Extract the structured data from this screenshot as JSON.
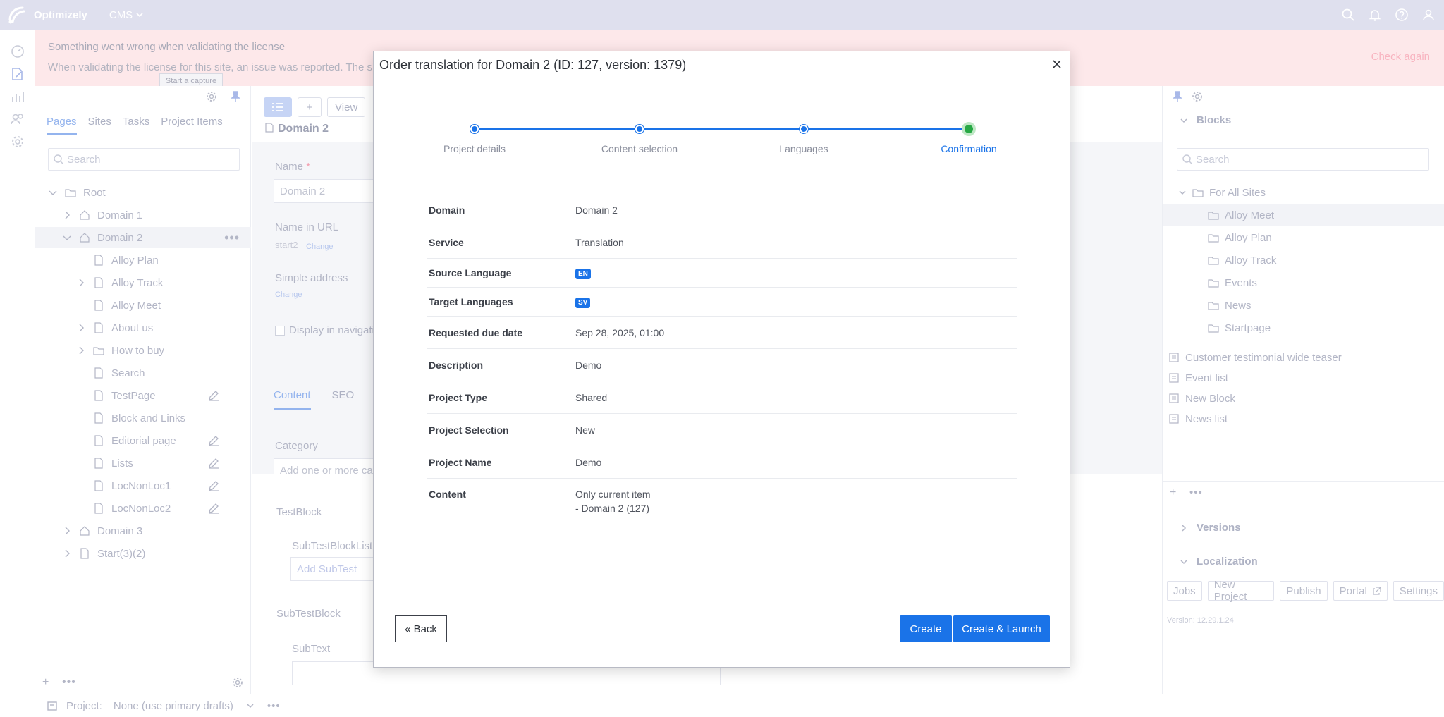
{
  "topbar": {
    "brand": "Optimizely",
    "product_menu": "CMS"
  },
  "banner": {
    "title": "Something went wrong when validating the license",
    "message": "When validating the license for this site, an issue was reported. The si",
    "action": "Check again"
  },
  "tooltip": "Start a capture",
  "left_pane": {
    "tabs": [
      "Pages",
      "Sites",
      "Tasks",
      "Project Items"
    ],
    "search_placeholder": "Search",
    "tree": [
      {
        "label": "Root",
        "depth": 0,
        "icon": "folder",
        "toggle": "open"
      },
      {
        "label": "Domain 1",
        "depth": 1,
        "icon": "home",
        "toggle": "closed"
      },
      {
        "label": "Domain 2",
        "depth": 1,
        "icon": "home",
        "toggle": "open",
        "selected": true
      },
      {
        "label": "Alloy Plan",
        "depth": 2,
        "icon": "page"
      },
      {
        "label": "Alloy Track",
        "depth": 2,
        "icon": "page",
        "toggle": "closed"
      },
      {
        "label": "Alloy Meet",
        "depth": 2,
        "icon": "page"
      },
      {
        "label": "About us",
        "depth": 2,
        "icon": "page",
        "toggle": "closed"
      },
      {
        "label": "How to buy",
        "depth": 2,
        "icon": "folder",
        "toggle": "closed"
      },
      {
        "label": "Search",
        "depth": 2,
        "icon": "page"
      },
      {
        "label": "TestPage",
        "depth": 2,
        "icon": "page",
        "edit": true
      },
      {
        "label": "Block and Links",
        "depth": 2,
        "icon": "page"
      },
      {
        "label": "Editorial page",
        "depth": 2,
        "icon": "page",
        "edit": true
      },
      {
        "label": "Lists",
        "depth": 2,
        "icon": "page",
        "edit": true
      },
      {
        "label": "LocNonLoc1",
        "depth": 2,
        "icon": "page",
        "edit": true
      },
      {
        "label": "LocNonLoc2",
        "depth": 2,
        "icon": "page",
        "edit": true
      },
      {
        "label": "Domain 3",
        "depth": 1,
        "icon": "home",
        "toggle": "closed"
      },
      {
        "label": "Start(3)(2)",
        "depth": 1,
        "icon": "page",
        "toggle": "closed"
      }
    ]
  },
  "editor": {
    "view_button": "View",
    "title": "Domain 2",
    "name_label": "Name",
    "name_value": "Domain 2",
    "url_label": "Name in URL",
    "url_value": "start2",
    "change_link": "Change",
    "simple_address_label": "Simple address",
    "display_in_nav": "Display in navigati",
    "tabs": [
      "Content",
      "SEO"
    ],
    "category_label": "Category",
    "category_placeholder": "Add one or more ca",
    "testblock_label": "TestBlock",
    "subtestblocklist_label": "SubTestBlockList",
    "add_subtest": "Add SubTest",
    "subtestblock_label": "SubTestBlock",
    "subtext_label": "SubText"
  },
  "right_pane": {
    "blocks_title": "Blocks",
    "search_placeholder": "Search",
    "folders": [
      "For All Sites",
      "Alloy Meet",
      "Alloy Plan",
      "Alloy Track",
      "Events",
      "News",
      "Startpage"
    ],
    "blocks": [
      "Customer testimonial wide teaser",
      "Event list",
      "New Block",
      "News list"
    ],
    "versions_title": "Versions",
    "localization_title": "Localization",
    "loc_buttons": [
      "Jobs",
      "New Project",
      "Publish",
      "Portal",
      "Settings"
    ],
    "version_text": "Version: 12.29.1.24"
  },
  "bottombar": {
    "project_label": "Project:",
    "project_value": "None (use primary drafts)"
  },
  "dialog": {
    "title": "Order translation for Domain 2 (ID: 127, version: 1379)",
    "steps": [
      "Project details",
      "Content selection",
      "Languages",
      "Confirmation"
    ],
    "current_step": 3,
    "summary": [
      {
        "key": "Domain",
        "value": "Domain 2"
      },
      {
        "key": "Service",
        "value": "Translation"
      },
      {
        "key": "Source Language",
        "badge": "EN"
      },
      {
        "key": "Target Languages",
        "badge": "SV"
      },
      {
        "key": "Requested due date",
        "value": "Sep 28, 2025, 01:00"
      },
      {
        "key": "Description",
        "value": "Demo"
      },
      {
        "key": "Project Type",
        "value": "Shared"
      },
      {
        "key": "Project Selection",
        "value": "New"
      },
      {
        "key": "Project Name",
        "value": "Demo"
      },
      {
        "key": "Content",
        "value": "Only current item",
        "value2": "- Domain 2 (127)"
      }
    ],
    "back_button": "« Back",
    "create_button": "Create",
    "create_launch_button": "Create & Launch"
  },
  "colors": {
    "accent": "#1a73e8",
    "success": "#27a844",
    "topbar": "#dfe0ee",
    "banner": "#fde8ea"
  }
}
